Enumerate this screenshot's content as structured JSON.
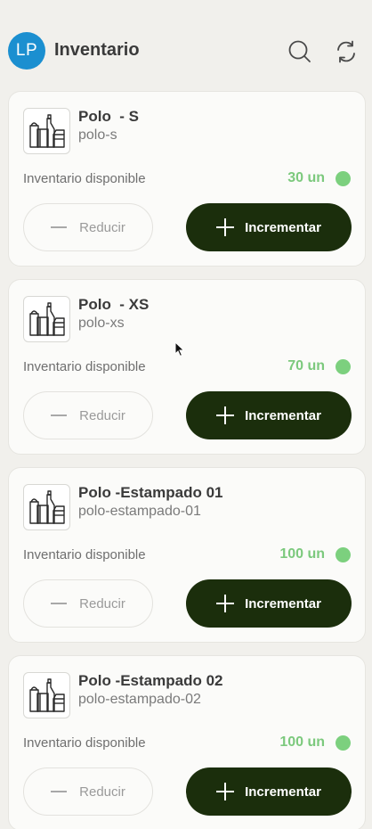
{
  "header": {
    "avatar_initials": "LP",
    "title": "Inventario",
    "search_icon": "search-icon",
    "refresh_icon": "refresh-icon"
  },
  "common": {
    "inventory_label": "Inventario disponible",
    "reduce_label": "Reducir",
    "increment_label": "Incrementar"
  },
  "products": [
    {
      "name": "Polo  - S",
      "slug": "polo-s",
      "stock": "30 un"
    },
    {
      "name": "Polo  - XS",
      "slug": "polo-xs",
      "stock": "70 un"
    },
    {
      "name": "Polo -Estampado 01",
      "slug": "polo-estampado-01",
      "stock": "100 un"
    },
    {
      "name": "Polo -Estampado 02",
      "slug": "polo-estampado-02",
      "stock": "100 un"
    }
  ],
  "colors": {
    "avatar": "#1b8fd0",
    "primary_button": "#1b2e0c",
    "stock_ok": "#7cd07e",
    "background": "#f1f0ec"
  }
}
